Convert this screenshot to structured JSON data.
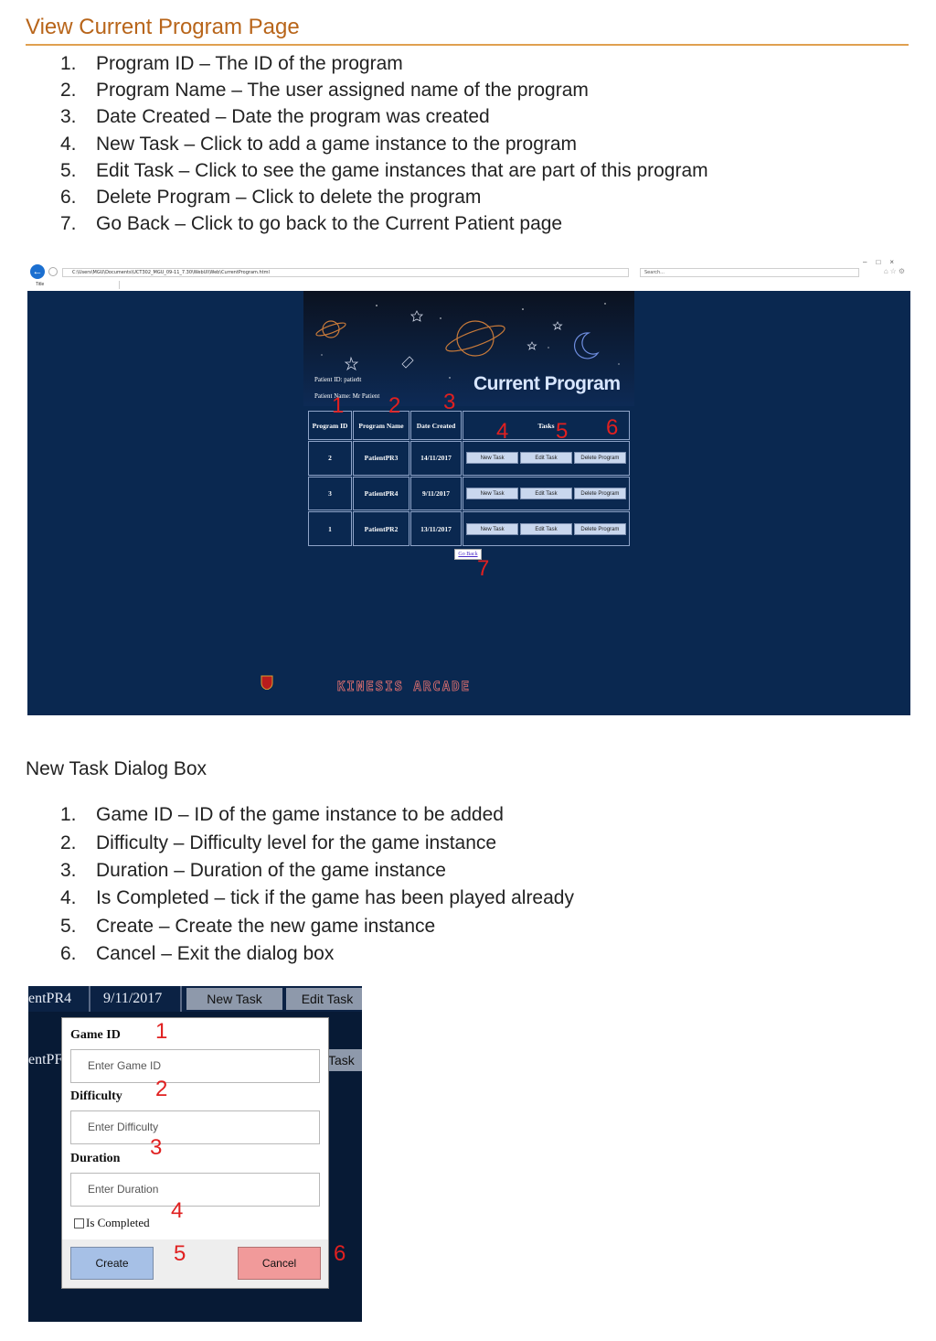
{
  "doc": {
    "title": "View Current Program Page",
    "list1": [
      {
        "num": "1.",
        "text": "Program ID – The ID of the program"
      },
      {
        "num": "2.",
        "text": "Program Name – The user assigned name of the program"
      },
      {
        "num": "3.",
        "text": "Date Created – Date the program was created"
      },
      {
        "num": "4.",
        "text": "New Task – Click to add a game instance to the program"
      },
      {
        "num": "5.",
        "text": "Edit Task – Click to see the game instances that are part of this program"
      },
      {
        "num": "6.",
        "text": "Delete Program – Click to delete the program"
      },
      {
        "num": "7.",
        "text": "Go Back – Click to go back to the Current Patient page"
      }
    ],
    "subtitle": "New Task Dialog Box",
    "list2": [
      {
        "num": "1.",
        "text": "Game ID – ID of the game instance to be added"
      },
      {
        "num": "2.",
        "text": "Difficulty – Difficulty level for the game instance"
      },
      {
        "num": "3.",
        "text": "Duration – Duration of the game instance"
      },
      {
        "num": "4.",
        "text": "Is Completed – tick if the game has been played already"
      },
      {
        "num": "5.",
        "text": "Create – Create the new game instance"
      },
      {
        "num": "6.",
        "text": "Cancel – Exit the dialog box"
      }
    ]
  },
  "browser": {
    "address": "C:\\Users\\MGU\\Documents\\UCT302_MGU_09-11_7.30\\WebUI\\Web\\CurrentProgram.html",
    "search_placeholder": "Search...",
    "tab_title": "Title",
    "page": {
      "header_title": "Current Program",
      "patient_id": "Patient ID: patient",
      "patient_name": "Patient Name: Mr Patient",
      "columns": [
        "Program ID",
        "Program Name",
        "Date Created",
        "Tasks"
      ],
      "rows": [
        {
          "id": "2",
          "name": "PatientPR3",
          "date": "14/11/2017"
        },
        {
          "id": "3",
          "name": "PatientPR4",
          "date": "9/11/2017"
        },
        {
          "id": "1",
          "name": "PatientPR2",
          "date": "13/11/2017"
        }
      ],
      "btn_new_task": "New Task",
      "btn_edit_task": "Edit Task",
      "btn_delete_program": "Delete Program",
      "go_back": "Go Back",
      "footer_brand": "KINESIS ARCADE"
    },
    "markers": [
      "1",
      "2",
      "3",
      "4",
      "5",
      "6",
      "7"
    ]
  },
  "dialog_shot": {
    "bg_name1": "entPR4",
    "bg_date1": "9/11/2017",
    "bg_new_task": "New Task",
    "bg_edit_task": "Edit Task",
    "bg_name2": "entPF",
    "bg_btn2": "Task",
    "labels": {
      "game_id": "Game ID",
      "difficulty": "Difficulty",
      "duration": "Duration",
      "is_completed": "Is Completed"
    },
    "placeholders": {
      "game_id": "Enter Game ID",
      "difficulty": "Enter Difficulty",
      "duration": "Enter Duration"
    },
    "create": "Create",
    "cancel": "Cancel",
    "markers": [
      "1",
      "2",
      "3",
      "4",
      "5",
      "6"
    ]
  },
  "colors": {
    "heading": "#b8651a",
    "page_bg": "#0a2850",
    "marker": "#e02020",
    "create_btn": "#a6c0e6",
    "cancel_btn": "#f19a9a"
  }
}
